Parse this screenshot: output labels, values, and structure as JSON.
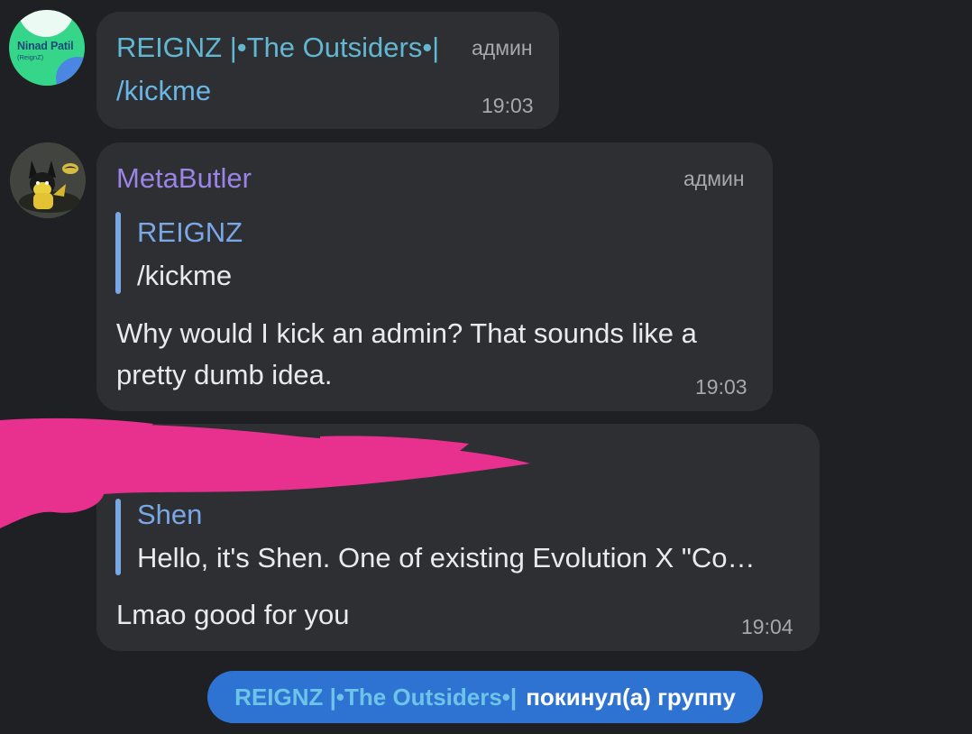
{
  "messages": [
    {
      "sender": "REIGNZ |•The Outsiders•|",
      "badge": "админ",
      "text": "/kickme",
      "time": "19:03",
      "avatar": {
        "name": "Ninad Patil",
        "sub": "(ReignZ)"
      }
    },
    {
      "sender": "MetaButler",
      "badge": "админ",
      "reply_to": {
        "name": "REIGNZ",
        "text": "/kickme"
      },
      "text_lines": [
        "Why would I kick an admin? That sounds like a",
        "pretty dumb idea."
      ],
      "time": "19:03",
      "avatar": {
        "icon": "batman-pikachu-icon"
      }
    },
    {
      "sender": "",
      "reply_to": {
        "name": "Shen",
        "text": "Hello, it's Shen. One of existing Evolution X \"Co…"
      },
      "text": "Lmao good for you",
      "time": "19:04"
    }
  ],
  "service": {
    "name": "REIGNZ |•The Outsiders•|",
    "action": "покинул(а) группу"
  },
  "colors": {
    "background": "#1f2023",
    "bubble": "#2e2f33",
    "accent_blue": "#2f73d2",
    "scribble": "#e8308f"
  }
}
